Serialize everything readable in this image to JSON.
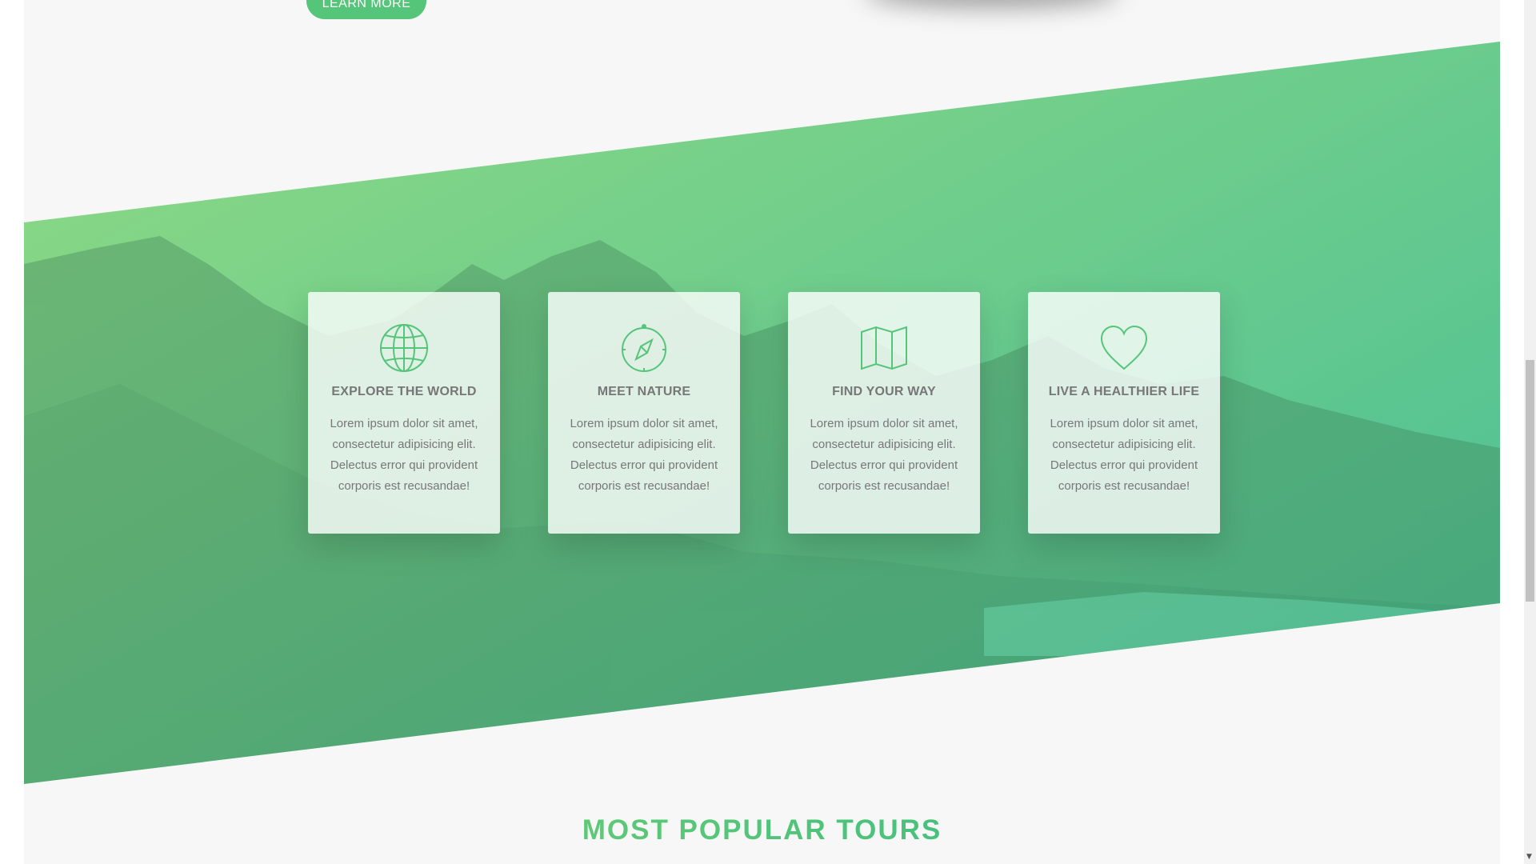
{
  "hero": {
    "learn_more_label": "LEARN MORE"
  },
  "features": [
    {
      "icon": "globe-icon",
      "title": "EXPLORE THE WORLD",
      "text": "Lorem ipsum dolor sit amet, consectetur adipisicing elit. Delectus error qui provident corporis est recusandae!"
    },
    {
      "icon": "compass-icon",
      "title": "MEET NATURE",
      "text": "Lorem ipsum dolor sit amet, consectetur adipisicing elit. Delectus error qui provident corporis est recusandae!"
    },
    {
      "icon": "map-icon",
      "title": "FIND YOUR WAY",
      "text": "Lorem ipsum dolor sit amet, consectetur adipisicing elit. Delectus error qui provident corporis est recusandae!"
    },
    {
      "icon": "heart-icon",
      "title": "LIVE A HEALTHIER LIFE",
      "text": "Lorem ipsum dolor sit amet, consectetur adipisicing elit. Delectus error qui provident corporis est recusandae!"
    }
  ],
  "tours": {
    "heading": "MOST POPULAR TOURS"
  },
  "colors": {
    "primary_light": "#7ed56f",
    "primary": "#55c57a",
    "primary_dark": "#28b485",
    "text_grey": "#777777",
    "background": "#f7f7f7"
  }
}
